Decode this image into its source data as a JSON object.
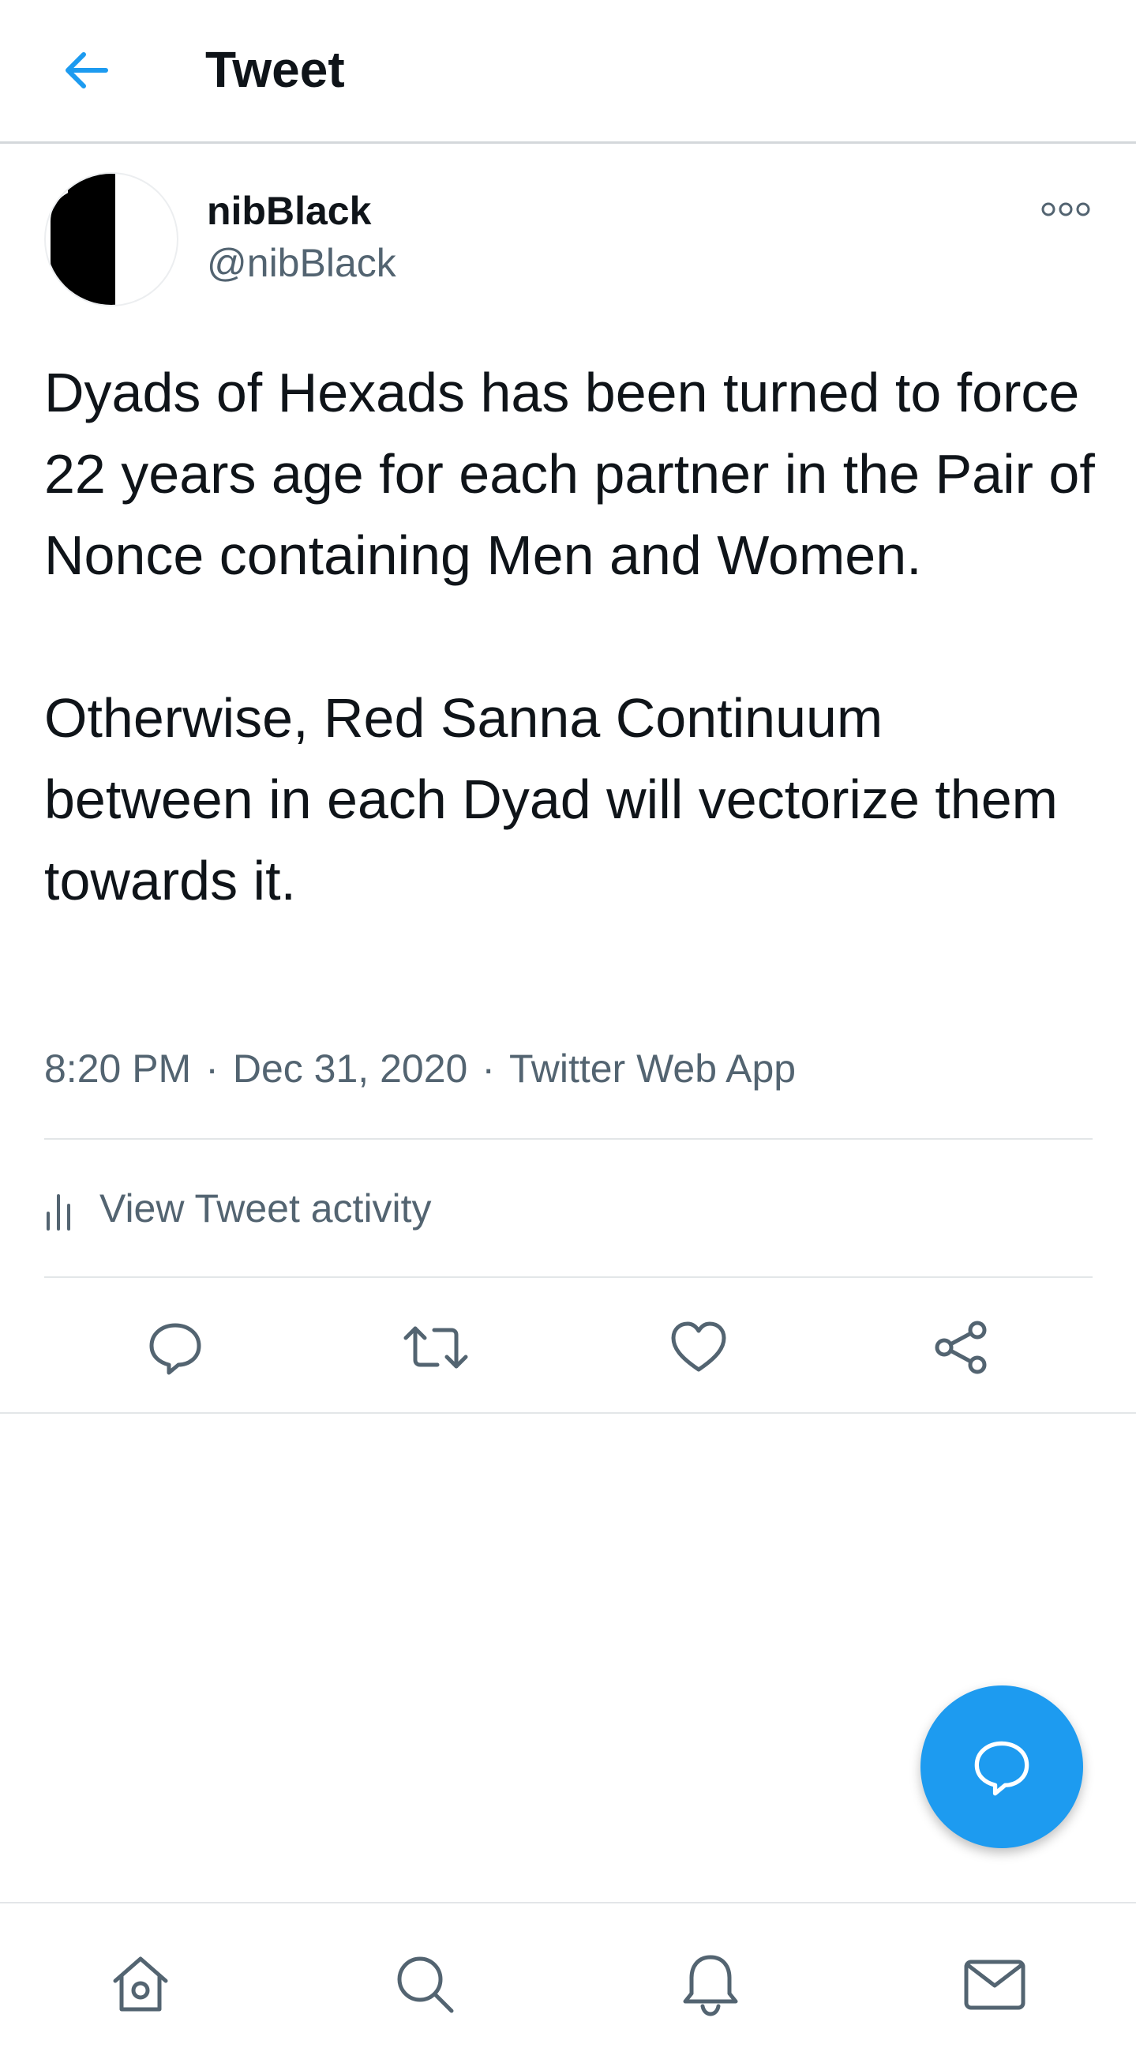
{
  "header": {
    "title": "Tweet",
    "back_icon": "arrow-left-icon"
  },
  "colors": {
    "accent": "#1d9bf0",
    "text_primary": "#0f1419",
    "text_secondary": "#536471",
    "divider": "#e3e6e8"
  },
  "tweet": {
    "author_name": "nibBlack",
    "author_handle": "@nibBlack",
    "paragraphs": [
      "Dyads of Hexads has been turned to force 22 years age for each partner in the Pair of Nonce containing Men and Women.",
      "Otherwise, Red Sanna Continuum between in each Dyad will vectorize them towards it."
    ],
    "time": "8:20 PM",
    "date": "Dec 31, 2020",
    "source": "Twitter Web App",
    "separator": "·"
  },
  "activity": {
    "label": "View Tweet activity",
    "icon": "bar-chart-icon"
  },
  "actions": [
    {
      "name": "reply",
      "icon": "reply-icon"
    },
    {
      "name": "retweet",
      "icon": "retweet-icon"
    },
    {
      "name": "like",
      "icon": "heart-icon"
    },
    {
      "name": "share",
      "icon": "share-icon"
    }
  ],
  "fab": {
    "icon": "compose-reply-icon"
  },
  "bottom_nav": [
    {
      "name": "home",
      "icon": "home-icon"
    },
    {
      "name": "search",
      "icon": "search-icon"
    },
    {
      "name": "notifications",
      "icon": "bell-icon"
    },
    {
      "name": "messages",
      "icon": "mail-icon"
    }
  ]
}
